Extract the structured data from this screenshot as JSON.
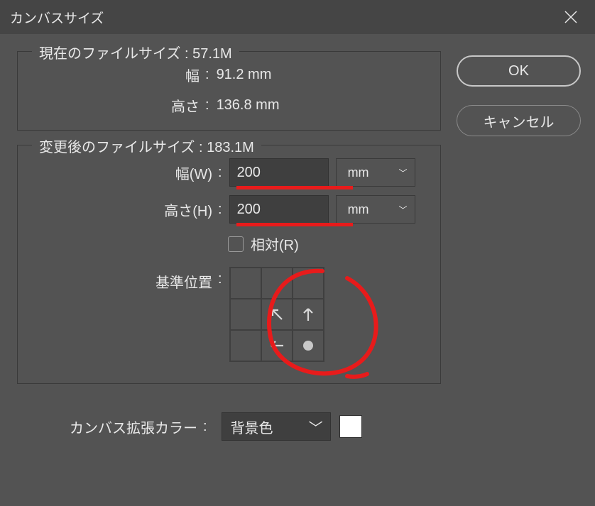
{
  "title": "カンバスサイズ",
  "current": {
    "legend": "現在のファイルサイズ : 57.1M",
    "width_label": "幅",
    "width_value": "91.2 mm",
    "height_label": "高さ",
    "height_value": "136.8 mm"
  },
  "new": {
    "legend": "変更後のファイルサイズ : 183.1M",
    "width_label": "幅(W)",
    "width_value": "200",
    "height_label": "高さ(H)",
    "height_value": "200",
    "unit": "mm",
    "relative_label": "相対(R)",
    "anchor_label": "基準位置"
  },
  "extension": {
    "label": "カンバス拡張カラー",
    "value": "背景色"
  },
  "buttons": {
    "ok": "OK",
    "cancel": "キャンセル"
  }
}
